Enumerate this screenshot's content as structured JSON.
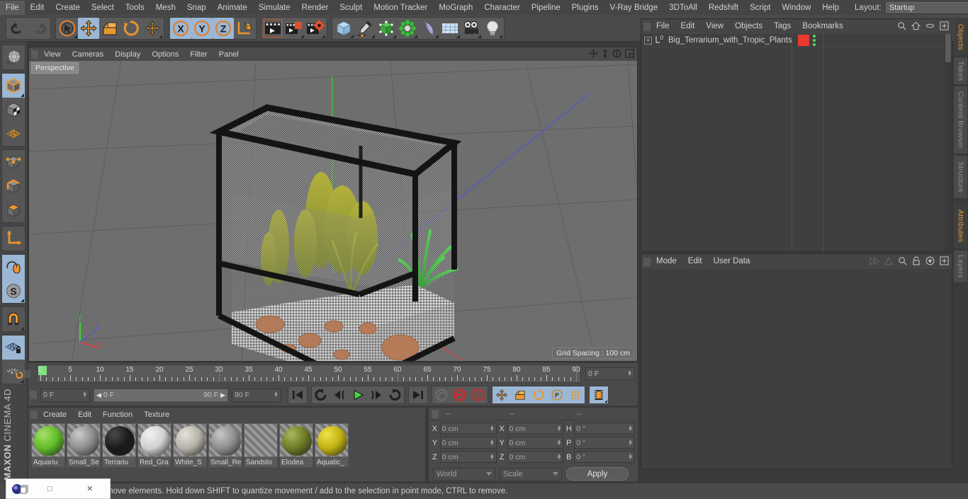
{
  "app": {
    "brand_line1": "MAXON",
    "brand_line2": "CINEMA 4D"
  },
  "top_menu": {
    "items": [
      {
        "label": "File"
      },
      {
        "label": "Edit"
      },
      {
        "label": "Create"
      },
      {
        "label": "Select"
      },
      {
        "label": "Tools"
      },
      {
        "label": "Mesh"
      },
      {
        "label": "Snap"
      },
      {
        "label": "Animate"
      },
      {
        "label": "Simulate"
      },
      {
        "label": "Render"
      },
      {
        "label": "Sculpt"
      },
      {
        "label": "Motion Tracker"
      },
      {
        "label": "MoGraph"
      },
      {
        "label": "Character"
      },
      {
        "label": "Pipeline"
      },
      {
        "label": "Plugins"
      },
      {
        "label": "V-Ray Bridge"
      },
      {
        "label": "3DToAll"
      },
      {
        "label": "Redshift"
      },
      {
        "label": "Script"
      },
      {
        "label": "Window"
      },
      {
        "label": "Help"
      }
    ],
    "layout_label": "Layout:",
    "layout_value": "Startup",
    "search_icon": "search-icon"
  },
  "toolbar": {
    "groups": [
      {
        "name": "history",
        "buttons": [
          {
            "name": "undo-button",
            "icon": "undo-arrow-icon",
            "selected": false
          },
          {
            "name": "redo-button",
            "icon": "redo-arrow-icon",
            "selected": false,
            "disabled": true
          }
        ]
      },
      {
        "name": "transform-tools",
        "buttons": [
          {
            "name": "live-selection-tool",
            "icon": "cursor-circle-icon",
            "selected": false
          },
          {
            "name": "move-tool",
            "icon": "move-arrows-icon",
            "selected": true
          },
          {
            "name": "scale-tool",
            "icon": "scale-box-icon",
            "selected": false
          },
          {
            "name": "rotate-tool",
            "icon": "rotate-circle-icon",
            "selected": false
          },
          {
            "name": "dynamic-place-tool",
            "icon": "move-arrows-small-icon",
            "selected": false
          }
        ]
      },
      {
        "name": "axis-locks",
        "buttons": [
          {
            "name": "x-axis-lock",
            "icon": "x-axis-icon",
            "selected": true
          },
          {
            "name": "y-axis-lock",
            "icon": "y-axis-icon",
            "selected": true
          },
          {
            "name": "z-axis-lock",
            "icon": "z-axis-icon",
            "selected": true
          },
          {
            "name": "world-object-axis-toggle",
            "icon": "world-axis-cube-icon",
            "selected": false
          }
        ]
      },
      {
        "name": "render-tools",
        "buttons": [
          {
            "name": "render-view-button",
            "icon": "clapperboard-icon",
            "selected": false
          },
          {
            "name": "render-to-picture-viewer-button",
            "icon": "clapperboard-picture-icon",
            "selected": false
          },
          {
            "name": "render-settings-button",
            "icon": "clapperboard-gear-icon",
            "selected": false
          }
        ]
      },
      {
        "name": "create-objects",
        "buttons": [
          {
            "name": "add-cube-button",
            "icon": "cube-icon",
            "selected": false
          },
          {
            "name": "add-spline-button",
            "icon": "pen-spline-icon",
            "selected": false
          },
          {
            "name": "add-generator-button",
            "icon": "green-cube-icon",
            "selected": false
          },
          {
            "name": "add-array-button",
            "icon": "green-cluster-icon",
            "selected": false
          },
          {
            "name": "add-deformer-button",
            "icon": "bend-deformer-icon",
            "selected": false
          },
          {
            "name": "add-floor-button",
            "icon": "floor-grid-icon",
            "selected": false
          },
          {
            "name": "add-camera-button",
            "icon": "camera-icon",
            "selected": false
          },
          {
            "name": "add-light-button",
            "icon": "lightbulb-icon",
            "selected": false
          }
        ]
      }
    ]
  },
  "left_toolbar": {
    "groups": [
      {
        "buttons": [
          {
            "name": "undo-view-button",
            "icon": "globe-wire-icon",
            "selected": false
          }
        ]
      },
      {
        "buttons": [
          {
            "name": "model-mode-button",
            "icon": "model-cube-icon",
            "selected": true
          },
          {
            "name": "texture-mode-button",
            "icon": "texture-cube-icon",
            "selected": false
          },
          {
            "name": "workplane-mode-button",
            "icon": "workplane-grid-icon",
            "selected": false
          }
        ]
      },
      {
        "buttons": [
          {
            "name": "points-mode-button",
            "icon": "points-cube-icon",
            "selected": false
          },
          {
            "name": "edges-mode-button",
            "icon": "edges-cube-icon",
            "selected": false
          },
          {
            "name": "polygons-mode-button",
            "icon": "polygons-cube-icon",
            "selected": false
          }
        ]
      },
      {
        "buttons": [
          {
            "name": "object-axis-mode-button",
            "icon": "axis-arrow-icon",
            "selected": false
          }
        ]
      },
      {
        "buttons": [
          {
            "name": "enable-axis-button",
            "icon": "mouse-axis-icon",
            "selected": true
          },
          {
            "name": "soft-selection-button",
            "icon": "s-circle-icon",
            "selected": true
          }
        ]
      },
      {
        "buttons": [
          {
            "name": "snap-magnet-button",
            "icon": "magnet-icon",
            "selected": false
          }
        ]
      },
      {
        "buttons": [
          {
            "name": "lock-workplane-button",
            "icon": "grid-lock-icon",
            "selected": true
          },
          {
            "name": "planar-workplane-button",
            "icon": "grid-rotate-icon",
            "selected": false
          }
        ]
      }
    ]
  },
  "viewport": {
    "menu": [
      {
        "label": "View"
      },
      {
        "label": "Cameras"
      },
      {
        "label": "Display"
      },
      {
        "label": "Options"
      },
      {
        "label": "Filter"
      },
      {
        "label": "Panel"
      }
    ],
    "icons": [
      {
        "name": "pan-view-icon"
      },
      {
        "name": "dolly-view-icon"
      },
      {
        "name": "rotate-view-icon"
      },
      {
        "name": "maximize-view-icon"
      }
    ],
    "label": "Perspective",
    "grid_spacing": "Grid Spacing : 100 cm",
    "axis_gizmo": {
      "x_label": "X",
      "y_label": "Y",
      "z_label": "Z",
      "x_color": "#d64040",
      "y_color": "#4ccc4c",
      "z_color": "#4a6cd8"
    },
    "scene_object": "Big_Terrarium_with_Tropic_Plants",
    "background_color": "#6e6e6e",
    "grid_line_color": "#5c5c5c"
  },
  "timeline": {
    "ticks": [
      0,
      5,
      10,
      15,
      20,
      25,
      30,
      35,
      40,
      45,
      50,
      55,
      60,
      65,
      70,
      75,
      80,
      85,
      90
    ],
    "min_frame": 0,
    "max_frame": 90,
    "current_frame_field": "0 F"
  },
  "transport": {
    "current_frame": "0 F",
    "range_start": "0 F",
    "range_end": "90 F",
    "preview_end": "90 F",
    "buttons": [
      {
        "name": "go-to-start-button",
        "icon": "skip-to-start-icon",
        "selected": false
      },
      {
        "name": "play-backwards-loop-button",
        "icon": "loop-back-icon",
        "selected": false
      },
      {
        "name": "previous-frame-button",
        "icon": "step-back-icon",
        "selected": false
      },
      {
        "name": "play-button",
        "icon": "play-icon",
        "selected": false
      },
      {
        "name": "next-frame-button",
        "icon": "step-forward-icon",
        "selected": false
      },
      {
        "name": "play-forwards-loop-button",
        "icon": "loop-forward-icon",
        "selected": false
      },
      {
        "name": "go-to-end-button",
        "icon": "skip-to-end-icon",
        "selected": false
      },
      {
        "name": "record-active-objects-button",
        "icon": "record-key-icon",
        "selected": false
      },
      {
        "name": "autokeying-button",
        "icon": "autokey-red-icon",
        "selected": false
      },
      {
        "name": "keyframe-selection-button",
        "icon": "question-red-icon",
        "selected": false
      },
      {
        "name": "position-key-button",
        "icon": "move-arrows-icon",
        "selected": true
      },
      {
        "name": "scale-key-button",
        "icon": "scale-box-icon",
        "selected": true
      },
      {
        "name": "rotation-key-button",
        "icon": "rotate-circle-icon",
        "selected": true
      },
      {
        "name": "parameter-key-button",
        "icon": "p-circle-icon",
        "selected": true
      },
      {
        "name": "point-level-animation-button",
        "icon": "dots-grid-icon",
        "selected": true
      },
      {
        "name": "timeline-toggle-button",
        "icon": "filmstrip-icon",
        "selected": true
      }
    ]
  },
  "material_manager": {
    "menu": [
      {
        "label": "Create"
      },
      {
        "label": "Edit"
      },
      {
        "label": "Function"
      },
      {
        "label": "Texture"
      }
    ],
    "materials": [
      {
        "name": "Aquariu",
        "full_name": "Aquarium",
        "color": "#5fbb27",
        "highlight": "#a8e06a"
      },
      {
        "name": "Small_Sе",
        "full_name": "Small_Se",
        "color": "#8c8c8c",
        "highlight": "#cccccc"
      },
      {
        "name": "Terrariu",
        "full_name": "Terrarium",
        "color": "#1a1a1a",
        "highlight": "#4a4a4a"
      },
      {
        "name": "Red_Gra",
        "full_name": "Red_Gravel",
        "color": "#cfcfcf",
        "highlight": "#f2f2f2"
      },
      {
        "name": "White_S",
        "full_name": "White_Stone",
        "color": "#b5b0a8",
        "highlight": "#e6e2da"
      },
      {
        "name": "Small_Rе",
        "full_name": "Small_Rocks",
        "color": "#8d8d8d",
        "highlight": "#c7c7c7"
      },
      {
        "name": "Sandsto",
        "full_name": "Sandstone",
        "color": "#b4622f",
        "highlight": "#e2а06a"
      },
      {
        "name": "Elodea",
        "full_name": "Elodea",
        "color": "#6b7a24",
        "highlight": "#a9b95a"
      },
      {
        "name": "Aquatic_",
        "full_name": "Aquatic_Plant",
        "color": "#c0b011",
        "highlight": "#efe24a"
      }
    ]
  },
  "coordinates": {
    "header_dashes": [
      "--",
      "--",
      "--"
    ],
    "rows": [
      {
        "pos_label": "X",
        "pos_value": "0 cm",
        "size_label": "X",
        "size_value": "0 cm",
        "rot_label": "H",
        "rot_value": "0 °"
      },
      {
        "pos_label": "Y",
        "pos_value": "0 cm",
        "size_label": "Y",
        "size_value": "0 cm",
        "rot_label": "P",
        "rot_value": "0 °"
      },
      {
        "pos_label": "Z",
        "pos_value": "0 cm",
        "size_label": "Z",
        "size_value": "0 cm",
        "rot_label": "B",
        "rot_value": "0 °"
      }
    ],
    "coord_system": "World",
    "size_mode": "Scale",
    "apply_label": "Apply"
  },
  "object_manager": {
    "menu": [
      {
        "label": "File"
      },
      {
        "label": "Edit"
      },
      {
        "label": "View"
      },
      {
        "label": "Objects"
      },
      {
        "label": "Tags"
      },
      {
        "label": "Bookmarks"
      }
    ],
    "icons": [
      {
        "name": "search-icon"
      },
      {
        "name": "home-icon"
      },
      {
        "name": "ellipse-icon"
      },
      {
        "name": "expand-icon"
      }
    ],
    "rows": [
      {
        "name": "Big_Terrarium_with_Tropic_Plants",
        "expandable": true,
        "object_icon": "null-object-icon",
        "tag_color": "#e83a2e"
      }
    ]
  },
  "attributes_manager": {
    "menu": [
      {
        "label": "Mode"
      },
      {
        "label": "Edit"
      },
      {
        "label": "User Data"
      }
    ],
    "icons": [
      {
        "name": "history-back-icon"
      },
      {
        "name": "history-forward-icon"
      },
      {
        "name": "search-icon"
      },
      {
        "name": "lock-icon"
      },
      {
        "name": "target-icon"
      },
      {
        "name": "expand-icon"
      }
    ]
  },
  "right_tabs": {
    "upper": [
      {
        "label": "Objects",
        "active": true
      },
      {
        "label": "Takes",
        "active": false
      },
      {
        "label": "Content Browser",
        "active": false
      },
      {
        "label": "Structure",
        "active": false
      }
    ],
    "lower": [
      {
        "label": "Attributes",
        "active": true
      },
      {
        "label": "Layers",
        "active": false
      }
    ]
  },
  "status_bar": {
    "text": "Move elements. Hold down SHIFT to quantize movement / add to the selection in point mode, CTRL to remove.",
    "visible_text": "move elements. Hold down SHIFT to quantize movement / add to the selection in point mode, CTRL to remove."
  },
  "floating_window": {
    "icon": "app-logo-icon",
    "restore_label": "□",
    "close_label": "✕"
  }
}
